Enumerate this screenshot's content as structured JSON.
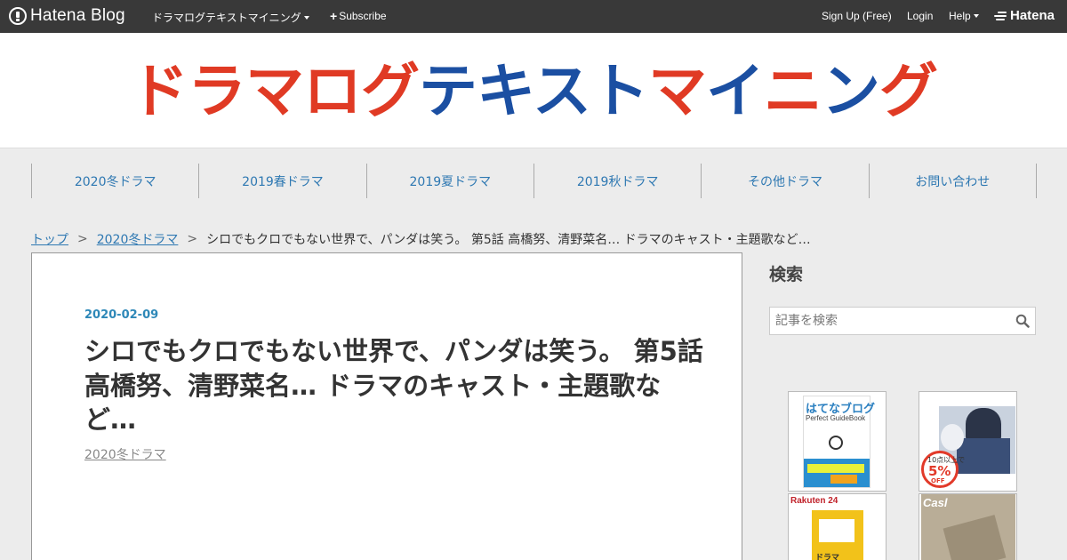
{
  "topbar": {
    "logo_text": "Hatena Blog",
    "blog_menu": "ドラマログテキストマイニング",
    "subscribe": "Subscribe",
    "signup": "Sign Up (Free)",
    "login": "Login",
    "help": "Help",
    "hatena": "Hatena",
    "background_color": "#393939"
  },
  "blog": {
    "title_parts": [
      {
        "text": "ドラマログ",
        "color": "#e03a24"
      },
      {
        "text": "テキスト",
        "color": "#1b4fa2"
      },
      {
        "text": "マ",
        "color": "#e03a24"
      },
      {
        "text": "イ",
        "color": "#1b4fa2"
      },
      {
        "text": "ニ",
        "color": "#e03a24"
      },
      {
        "text": "ン",
        "color": "#1b4fa2"
      },
      {
        "text": "グ",
        "color": "#e03a24"
      }
    ]
  },
  "nav": {
    "items": [
      "2020冬ドラマ",
      "2019春ドラマ",
      "2019夏ドラマ",
      "2019秋ドラマ",
      "その他ドラマ",
      "お問い合わせ"
    ],
    "link_color": "#2e78b2"
  },
  "breadcrumb": {
    "top": "トップ",
    "separator": ">",
    "category": "2020冬ドラマ",
    "current": "シロでもクロでもない世界で、パンダは笑う。 第5話 高橋努、清野菜名… ドラマのキャスト・主題歌など…"
  },
  "article": {
    "date": "2020-02-09",
    "title": "シロでもクロでもない世界で、パンダは笑う。 第5話 高橋努、清野菜名… ドラマのキャスト・主題歌など…",
    "category": "2020冬ドラマ"
  },
  "sidebar": {
    "search_heading": "検索",
    "search_placeholder": "記事を検索",
    "ads": [
      {
        "title": "はてなブログ",
        "subtitle": "Perfect GuideBook"
      },
      {
        "badge_top": "10点以上で",
        "badge_value": "5%",
        "badge_bottom": "OFF"
      },
      {
        "logo": "Rakuten 24",
        "label": "ドラマ"
      },
      {
        "logo": "Casl"
      }
    ]
  }
}
